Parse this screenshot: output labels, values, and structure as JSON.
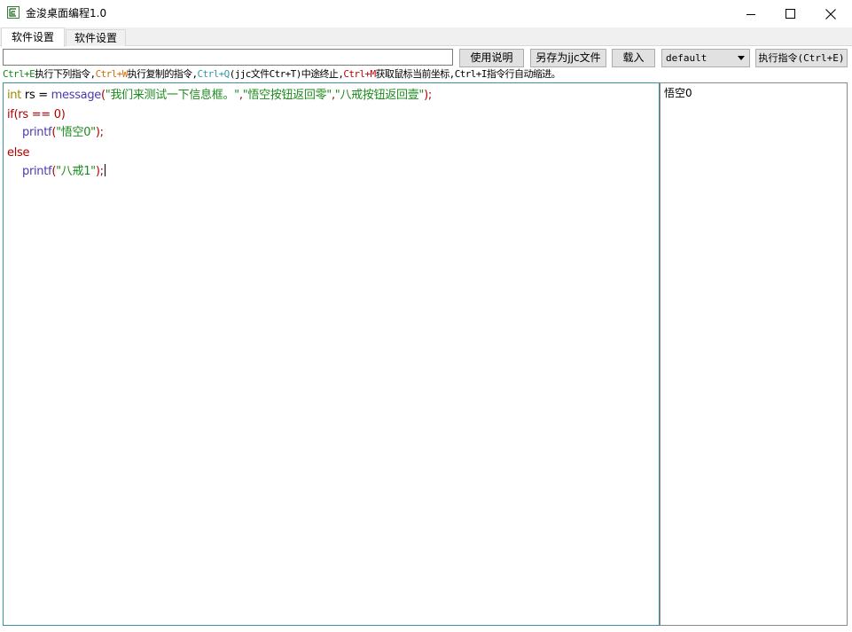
{
  "window": {
    "title": "金浚桌面编程1.0",
    "icon": "app-logo-icon",
    "controls": [
      "minimize-icon",
      "maximize-icon",
      "close-icon"
    ]
  },
  "tabs": [
    {
      "label": "软件设置",
      "selected": true
    },
    {
      "label": "软件设置",
      "selected": false
    }
  ],
  "toolbar": {
    "command_value": "",
    "help_label": "使用说明",
    "saveas_label": "另存为jjc文件",
    "load_label": "载入",
    "profile_value": "default",
    "exec_label": "执行指令(Ctrl+E)"
  },
  "hint": {
    "k1": "Ctrl+E",
    "t1": "执行下列指令,",
    "k2": "Ctrl+W",
    "t2": "执行复制的指令,",
    "k3": "Ctrl+Q",
    "t3": "(jjc文件Ctr+T)中途终止,",
    "k4": "Ctrl+M",
    "t4": "获取鼠标当前坐标,Ctrl+I指令行自动缩进。"
  },
  "code": {
    "l1_type": "int",
    "l1_var": " rs = ",
    "l1_fn": "message",
    "l1_open": "(",
    "l1_s1": "\"我们来测试一下信息框。\"",
    "l1_c1": ",",
    "l1_s2": "\"悟空按钮返回零\"",
    "l1_c2": ",",
    "l1_s3": "\"八戒按钮返回壹\"",
    "l1_close": ");",
    "l2": "if(rs == 0)",
    "l3_fn": "printf",
    "l3_open": "(",
    "l3_str": "\"悟空0\"",
    "l3_close": ");",
    "l4": "else",
    "l5_fn": "printf",
    "l5_open": "(",
    "l5_str": "\"八戒1\"",
    "l5_close": ");"
  },
  "output": {
    "text": "悟空0"
  },
  "colors": {
    "editor_border": "#3f8f9f",
    "keyword_type": "#9c8a00",
    "keyword_control": "#b00000",
    "function": "#4a3ab2",
    "string": "#1d8a1d"
  }
}
